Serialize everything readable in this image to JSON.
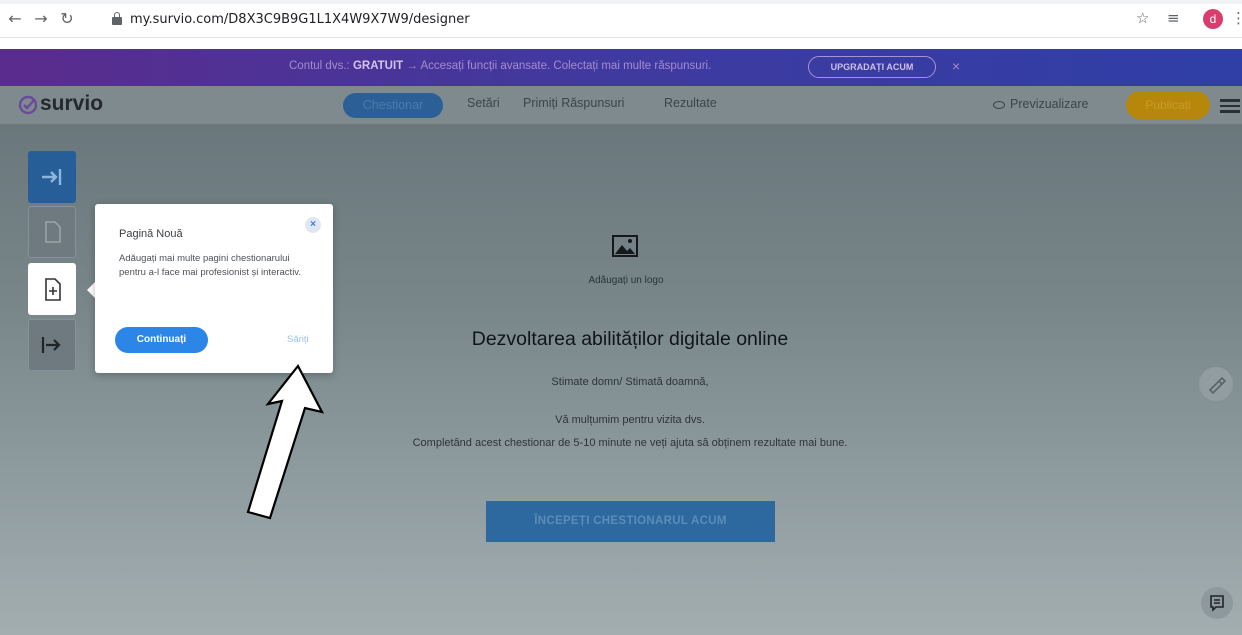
{
  "browser": {
    "url": "my.survio.com/D8X3C9B9G1L1X4W9X7W9/designer",
    "avatar_letter": "d"
  },
  "promo": {
    "text_prefix": "Contul dvs.:",
    "plan": "GRATUIT",
    "text_suffix": " → Accesați funcții avansate. Colectați mai multe răspunsuri.",
    "upgrade_label": "UPGRADAȚI ACUM",
    "close_label": "×"
  },
  "header": {
    "logo": "survio",
    "tabs": [
      {
        "label": "Chestionar"
      },
      {
        "label": "Setări"
      },
      {
        "label": "Primiți Răspunsuri"
      },
      {
        "label": "Rezultate"
      }
    ],
    "preview_label": "Previzualizare",
    "publish_label": "Publicați"
  },
  "popover": {
    "title": "Pagină Nouă",
    "body": "Adăugați mai multe pagini chestionarului pentru a-l face mai profesionist și interactiv.",
    "continue_label": "Continuați",
    "skip_label": "Săriți",
    "close_label": "×"
  },
  "survey": {
    "add_logo_label": "Adăugați un logo",
    "title": "Dezvoltarea abilităților digitale online",
    "greeting": "Stimate domn/ Stimată doamnă,",
    "thanks": "Vă mulțumim pentru vizita dvs.",
    "description": "Completând acest chestionar de 5-10 minute ne veți ajuta să obținem rezultate mai bune.",
    "start_label": "ÎNCEPEȚI CHESTIONARUL ACUM"
  },
  "colors": {
    "accent": "#2b86e8",
    "brand_blue": "#265f98",
    "publish": "#b7870c",
    "promo": "#4b33a0"
  }
}
